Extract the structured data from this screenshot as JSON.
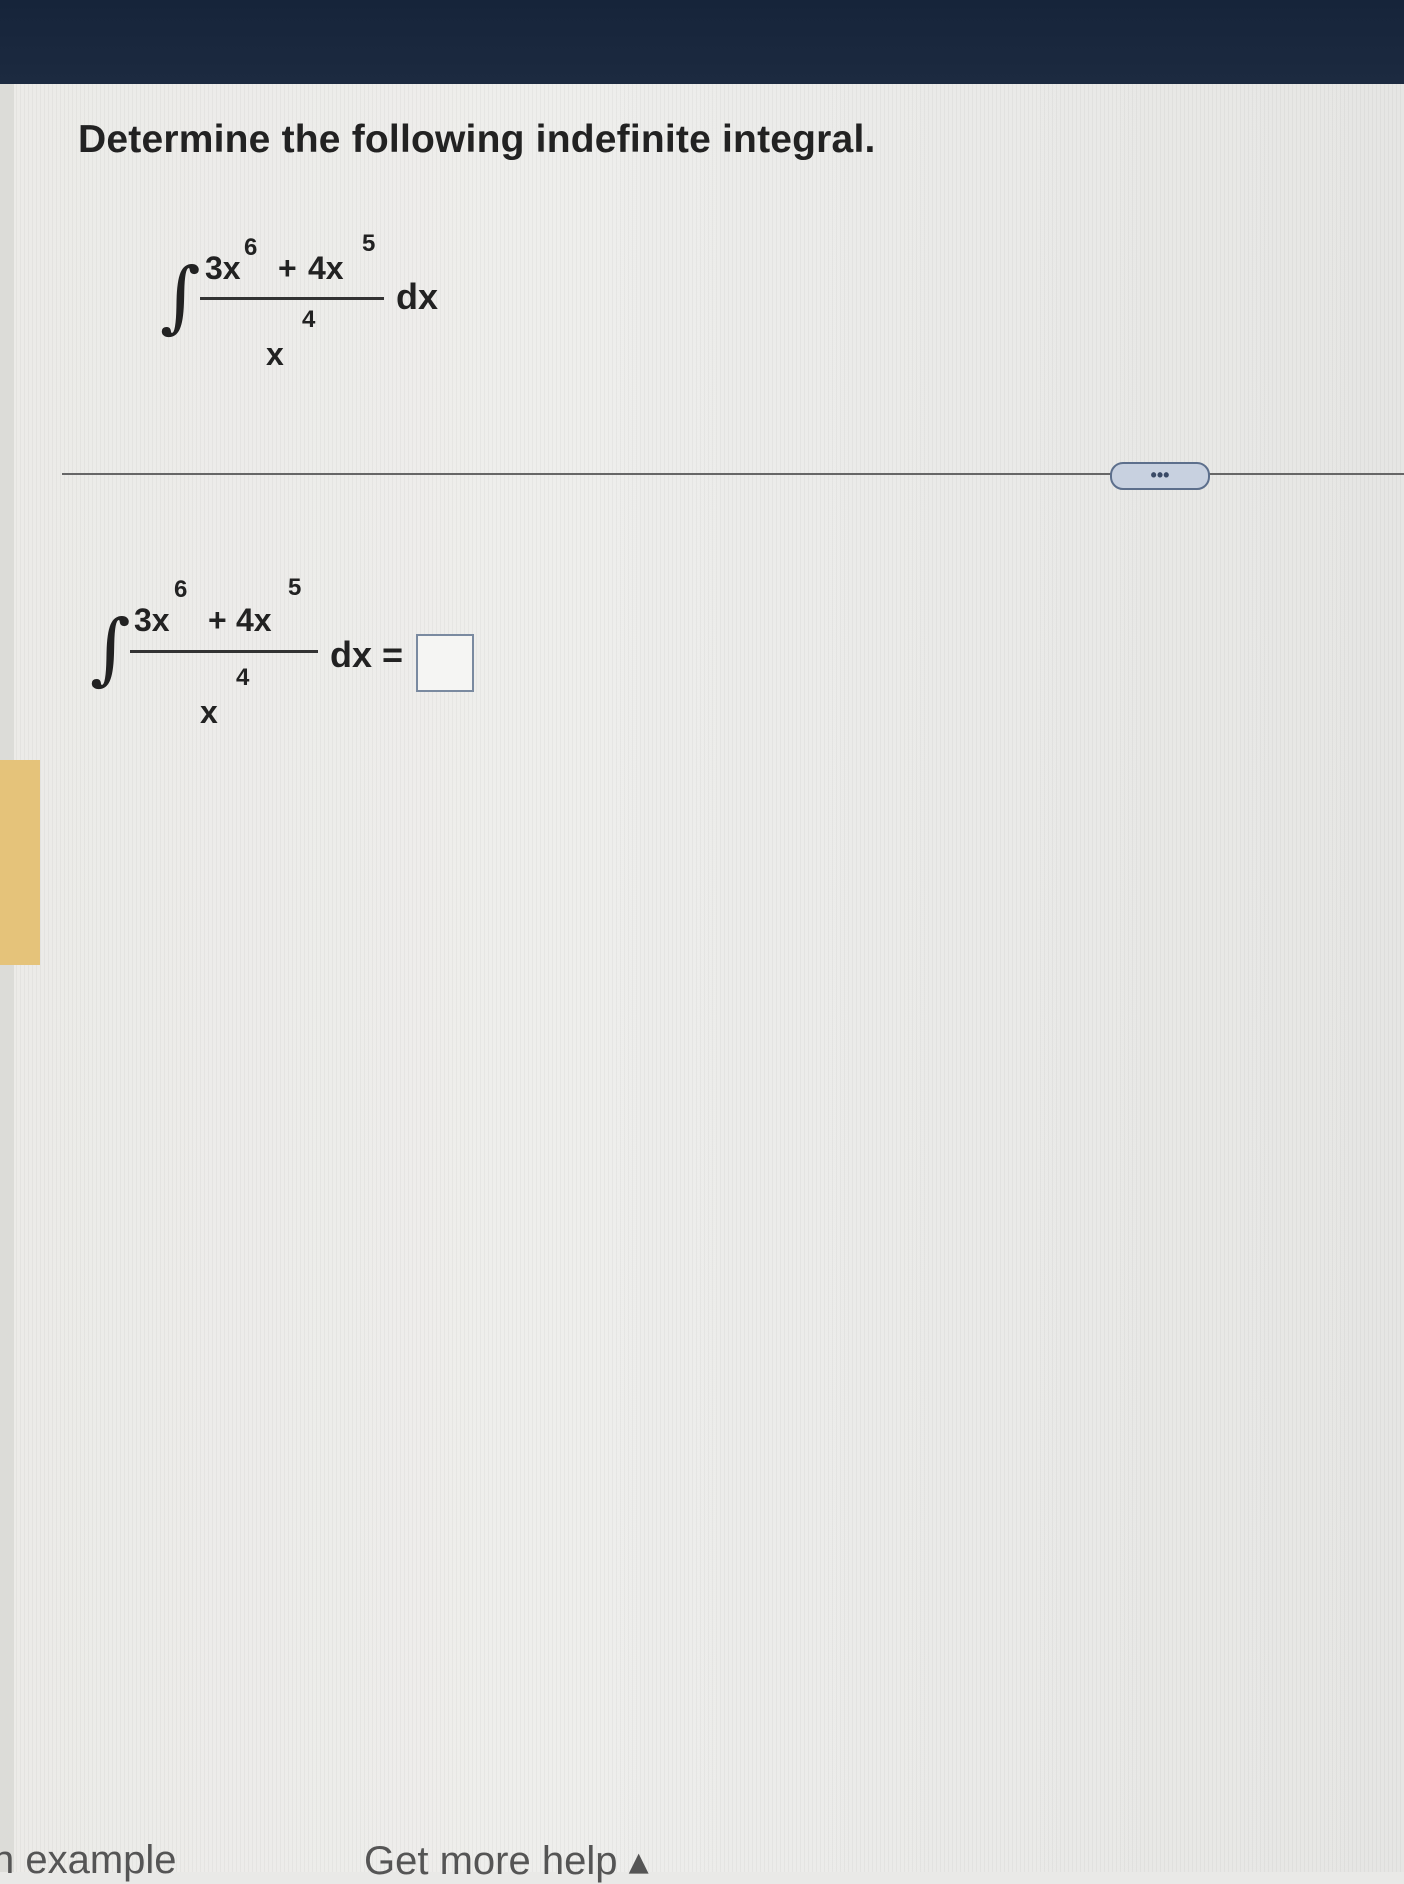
{
  "question": {
    "prompt": "Determine the following indefinite integral."
  },
  "integral": {
    "sign": "∫",
    "numerator_term1": "3x",
    "numerator_exp1": "6",
    "numerator_op": "+",
    "numerator_term2": "4x",
    "numerator_exp2": "5",
    "denominator": "x",
    "denominator_exp": "4",
    "differential": "dx"
  },
  "answer_row": {
    "equals": "=",
    "answer_value": ""
  },
  "toolbar": {
    "more_label": "•••"
  },
  "footer": {
    "left_label": "n example",
    "right_label": "Get more help ▴"
  },
  "colors": {
    "top_bar": "#16243a",
    "accent_strip": "#e5c37a",
    "button_border": "#5d6f8c"
  }
}
